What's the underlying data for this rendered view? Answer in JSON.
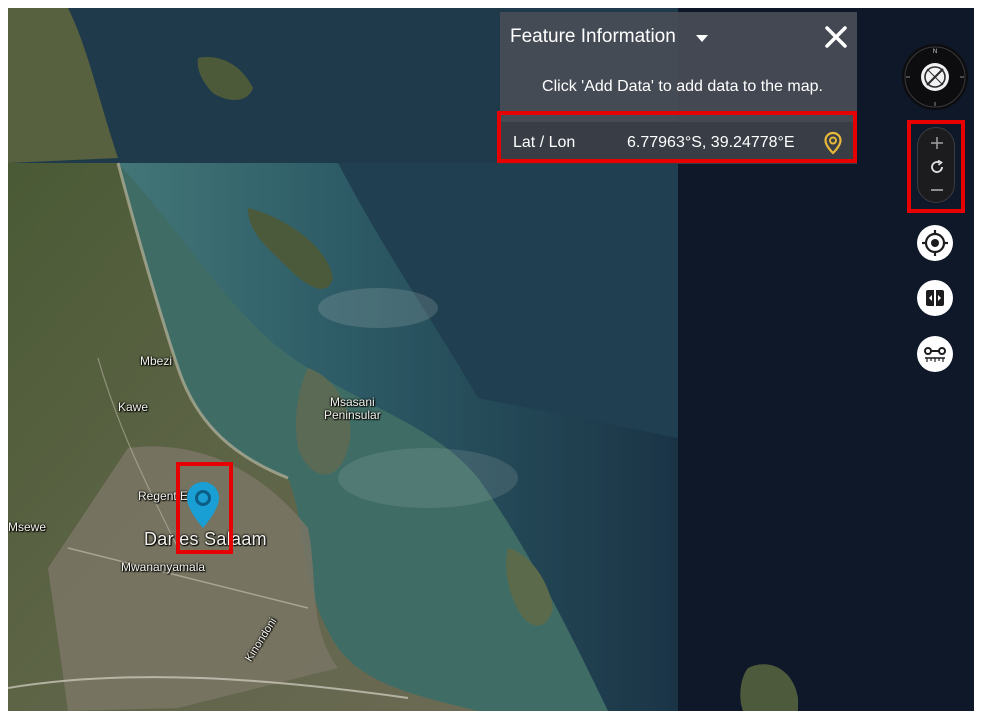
{
  "panel": {
    "title": "Feature Information",
    "message": "Click 'Add Data' to add data to the map.",
    "latlon_label": "Lat / Lon",
    "latlon_value": "6.77963°S, 39.24778°E"
  },
  "map": {
    "labels": {
      "mbezi": "Mbezi",
      "kawe": "Kawe",
      "msasani_line1": "Msasani",
      "msasani_line2": "Peninsular",
      "regent": "Regent Estate",
      "msewe": "Msewe",
      "dar": "Dar es Salaam",
      "mwananyamala": "Mwananyamala",
      "kinondoni": "Kinondoni"
    }
  },
  "controls": {
    "compass": "compass-icon",
    "zoom_in": "plus-icon",
    "reset": "refresh-icon",
    "zoom_out": "minus-icon",
    "locate": "crosshair-icon",
    "split": "split-view-icon",
    "measure": "ruler-icon"
  },
  "colors": {
    "highlight": "#e60000",
    "pin": "#1a9fd4",
    "latlon_pin": "#e8b83a",
    "panel_bg": "#484c56",
    "ocean": "#101b2c"
  }
}
